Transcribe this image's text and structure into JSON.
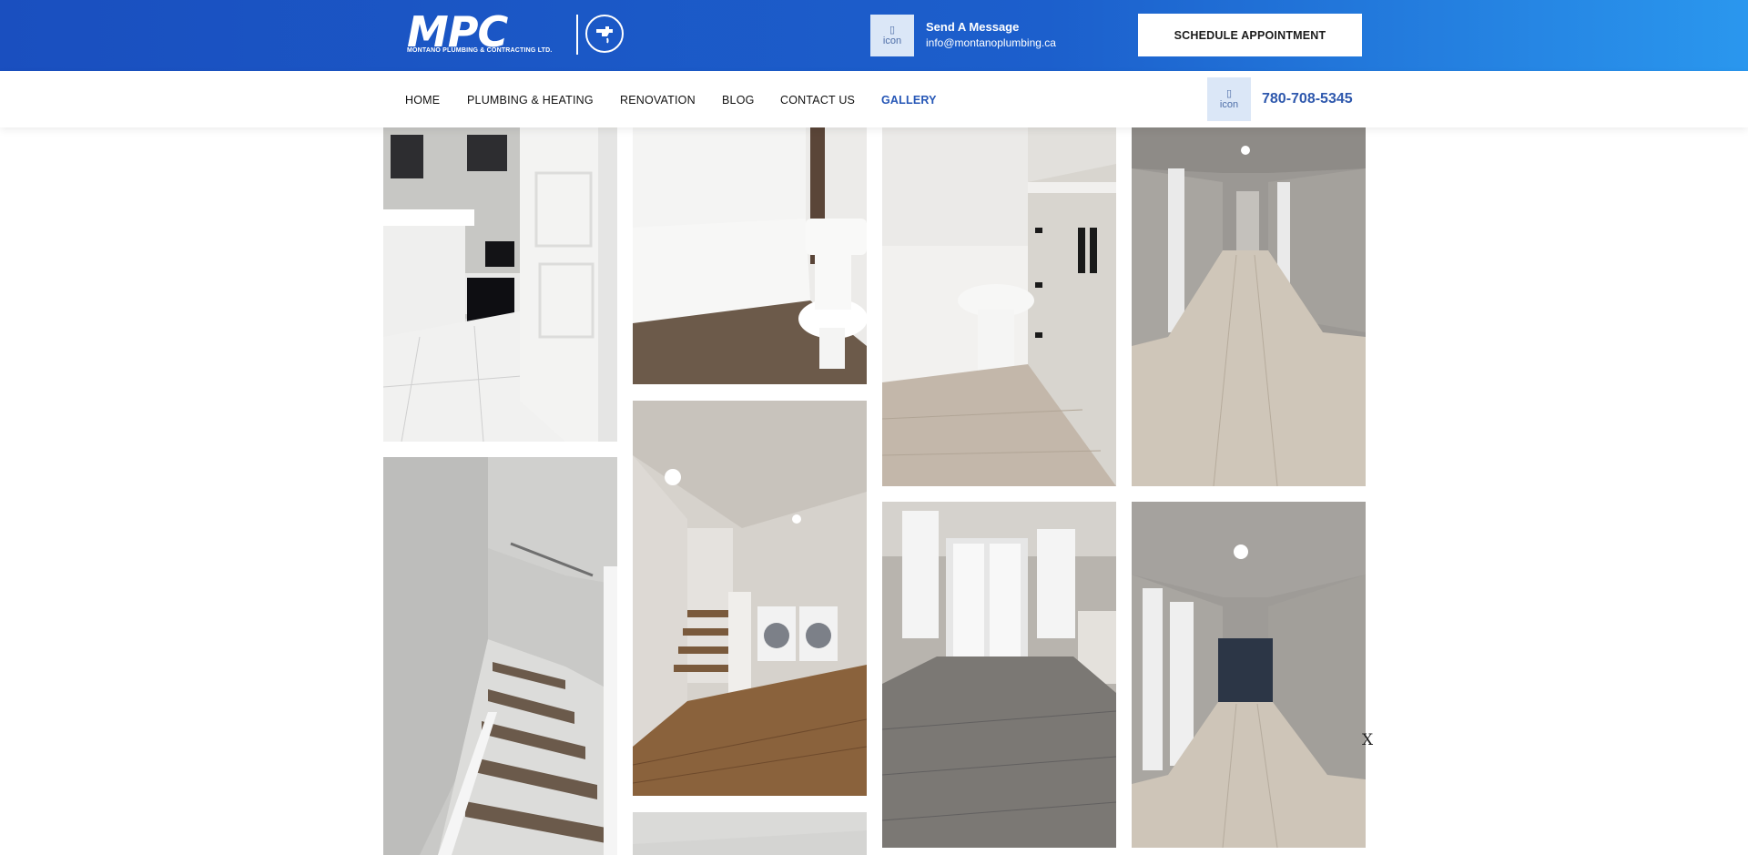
{
  "header": {
    "logo_text": "MPC",
    "logo_subtitle": "MONTANO PLUMBING & CONTRACTING LTD.",
    "message_icon_alt": "icon",
    "message_title": "Send A Message",
    "message_email": "info@montanoplumbing.ca",
    "schedule_label": "SCHEDULE APPOINTMENT"
  },
  "nav": {
    "items": [
      {
        "label": "HOME"
      },
      {
        "label": "PLUMBING & HEATING"
      },
      {
        "label": "RENOVATION"
      },
      {
        "label": "BLOG"
      },
      {
        "label": "CONTACT US"
      },
      {
        "label": "GALLERY"
      }
    ],
    "active": "GALLERY",
    "phone_icon_alt": "icon",
    "phone": "780-708-5345"
  },
  "gallery": {
    "photos": [
      {
        "subject": "bathroom vanity with open door",
        "tone": "#e6e6e4"
      },
      {
        "subject": "bathtub and toilet",
        "tone": "#ececea"
      },
      {
        "subject": "toilet beside vanity cabinet",
        "tone": "#e2e0dc"
      },
      {
        "subject": "hallway with laminate floor",
        "tone": "#bdbbb7"
      },
      {
        "subject": "staircase with wood treads",
        "tone": "#cfcfcd"
      },
      {
        "subject": "stairs and laundry machines",
        "tone": "#d3d0cb"
      },
      {
        "subject": "room with patio door",
        "tone": "#a9a7a3"
      },
      {
        "subject": "hallway with dark accent wall",
        "tone": "#bcbab6"
      },
      {
        "subject": "partial photo",
        "tone": "#d7d7d5"
      }
    ]
  },
  "close_label": "X",
  "colors": {
    "header_start": "#1a4fbf",
    "header_end": "#2a97ee",
    "accent": "#2556b6"
  }
}
